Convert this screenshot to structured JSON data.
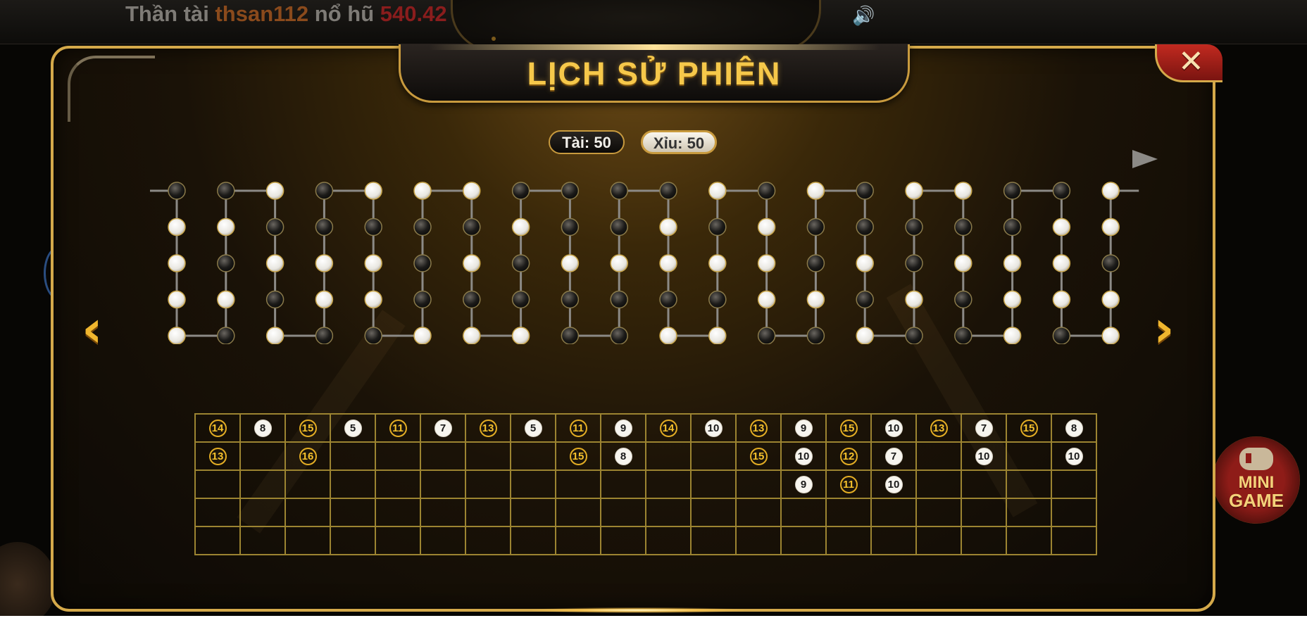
{
  "ticker": {
    "label": "Thần tài",
    "username": "thsan112",
    "mid": "nổ hũ",
    "amount": "540.42"
  },
  "top_icons": {
    "speaker": "speaker-icon"
  },
  "dialog": {
    "title": "LỊCH SỬ PHIÊN",
    "close_symbol": "✕"
  },
  "totals": {
    "tai": "Tài: 50",
    "xiu": "Xỉu: 50"
  },
  "nav": {
    "prev": "‹",
    "next": "›"
  },
  "mini_game": {
    "line1": "MINI",
    "line2": "GAME"
  },
  "colors": {
    "gold": "#f6c84a",
    "border": "#d4a94a",
    "tai_fill": "#1b140a",
    "xiu_fill": "#f7f5ef"
  },
  "bead_road": {
    "legend": {
      "dark": "tai",
      "light": "xiu"
    },
    "columns": [
      [
        "dark",
        "light",
        "light",
        "light",
        "light"
      ],
      [
        "dark",
        "light",
        "dark",
        "light",
        "dark"
      ],
      [
        "light",
        "dark",
        "light",
        "dark",
        "light"
      ],
      [
        "dark",
        "dark",
        "light",
        "light",
        "dark"
      ],
      [
        "light",
        "dark",
        "light",
        "light",
        "dark"
      ],
      [
        "light",
        "dark",
        "dark",
        "dark",
        "light"
      ],
      [
        "light",
        "dark",
        "light",
        "dark",
        "light"
      ],
      [
        "dark",
        "light",
        "dark",
        "dark",
        "light"
      ],
      [
        "dark",
        "dark",
        "light",
        "dark",
        "dark"
      ],
      [
        "dark",
        "dark",
        "light",
        "dark",
        "dark"
      ],
      [
        "dark",
        "light",
        "light",
        "dark",
        "light"
      ],
      [
        "light",
        "dark",
        "light",
        "dark",
        "light"
      ],
      [
        "dark",
        "light",
        "light",
        "light",
        "dark"
      ],
      [
        "light",
        "dark",
        "dark",
        "light",
        "dark"
      ],
      [
        "dark",
        "dark",
        "light",
        "dark",
        "light"
      ],
      [
        "light",
        "dark",
        "dark",
        "light",
        "dark"
      ],
      [
        "light",
        "dark",
        "light",
        "dark",
        "dark"
      ],
      [
        "dark",
        "dark",
        "light",
        "light",
        "light"
      ],
      [
        "dark",
        "light",
        "light",
        "light",
        "dark"
      ],
      [
        "light",
        "light",
        "dark",
        "light",
        "light"
      ]
    ]
  },
  "big_road": {
    "rows": 5,
    "columns": [
      [
        {
          "v": "14",
          "t": "tai"
        },
        {
          "v": "13",
          "t": "tai"
        }
      ],
      [
        {
          "v": "8",
          "t": "xiu"
        }
      ],
      [
        {
          "v": "15",
          "t": "tai"
        },
        {
          "v": "16",
          "t": "tai"
        }
      ],
      [
        {
          "v": "5",
          "t": "xiu"
        }
      ],
      [
        {
          "v": "11",
          "t": "tai"
        }
      ],
      [
        {
          "v": "7",
          "t": "xiu"
        }
      ],
      [
        {
          "v": "13",
          "t": "tai"
        }
      ],
      [
        {
          "v": "5",
          "t": "xiu"
        }
      ],
      [
        {
          "v": "11",
          "t": "tai"
        },
        {
          "v": "15",
          "t": "tai"
        }
      ],
      [
        {
          "v": "9",
          "t": "xiu"
        },
        {
          "v": "8",
          "t": "xiu"
        }
      ],
      [
        {
          "v": "14",
          "t": "tai"
        }
      ],
      [
        {
          "v": "10",
          "t": "xiu"
        }
      ],
      [
        {
          "v": "13",
          "t": "tai"
        },
        {
          "v": "15",
          "t": "tai"
        }
      ],
      [
        {
          "v": "9",
          "t": "xiu"
        },
        {
          "v": "10",
          "t": "xiu"
        },
        {
          "v": "9",
          "t": "xiu"
        }
      ],
      [
        {
          "v": "15",
          "t": "tai"
        },
        {
          "v": "12",
          "t": "tai"
        },
        {
          "v": "11",
          "t": "tai"
        }
      ],
      [
        {
          "v": "10",
          "t": "xiu"
        },
        {
          "v": "7",
          "t": "xiu"
        },
        {
          "v": "10",
          "t": "xiu"
        }
      ],
      [
        {
          "v": "13",
          "t": "tai"
        }
      ],
      [
        {
          "v": "7",
          "t": "xiu"
        },
        {
          "v": "10",
          "t": "xiu"
        }
      ],
      [
        {
          "v": "15",
          "t": "tai"
        }
      ],
      [
        {
          "v": "8",
          "t": "xiu"
        },
        {
          "v": "10",
          "t": "xiu"
        }
      ]
    ]
  }
}
